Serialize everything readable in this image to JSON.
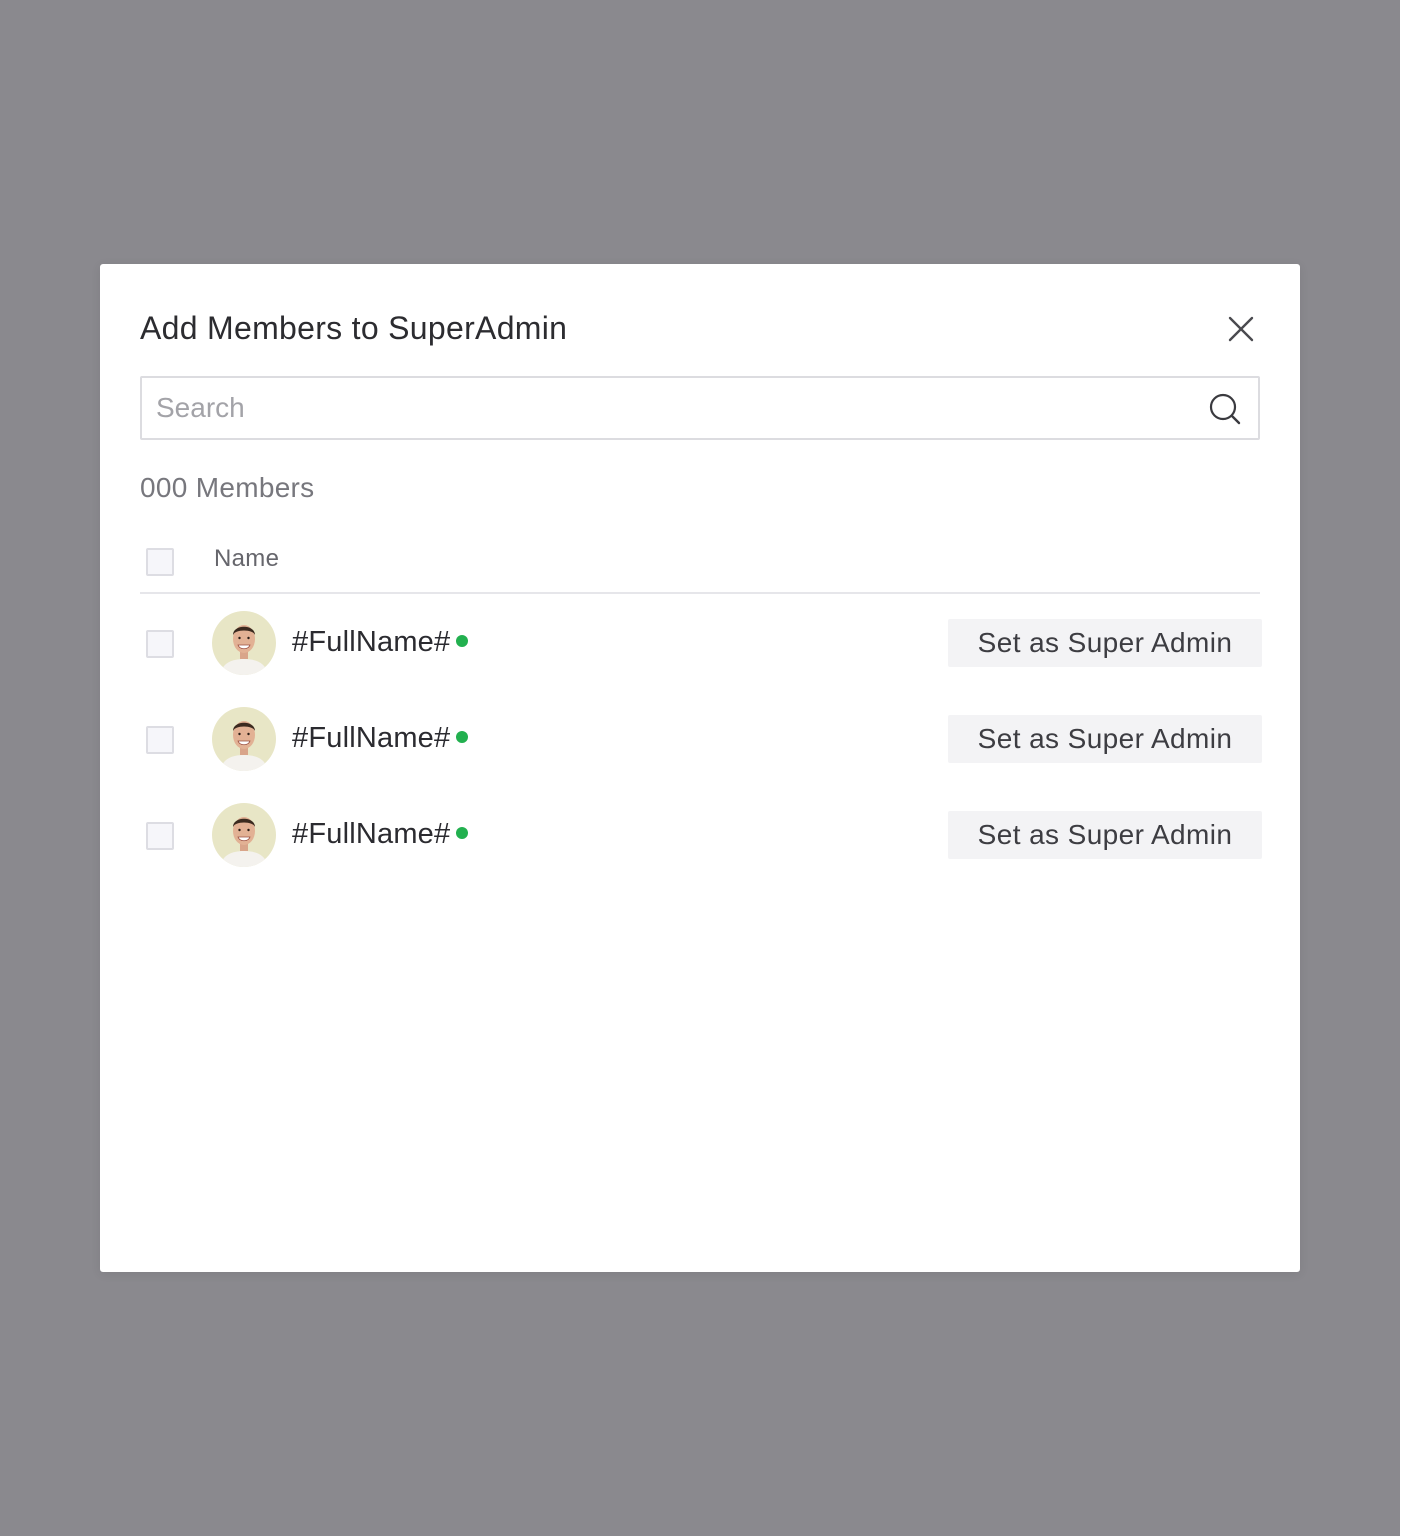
{
  "modal": {
    "title": "Add Members to SuperAdmin",
    "close_icon": "close-icon"
  },
  "search": {
    "placeholder": "Search",
    "value": "",
    "icon": "search-icon"
  },
  "members_summary": {
    "count_label": "000 Members"
  },
  "table": {
    "columns": [
      "Name"
    ],
    "header_checkbox_checked": false,
    "rows": [
      {
        "name": "#FullName#",
        "online": true,
        "checked": false,
        "action_label": "Set as Super Admin",
        "avatar_icon": "avatar"
      },
      {
        "name": "#FullName#",
        "online": true,
        "checked": false,
        "action_label": "Set as Super Admin",
        "avatar_icon": "avatar"
      },
      {
        "name": "#FullName#",
        "online": true,
        "checked": false,
        "action_label": "Set as Super Admin",
        "avatar_icon": "avatar"
      }
    ]
  },
  "colors": {
    "overlay": "#8a898e",
    "modal_background": "#ffffff",
    "online_status": "#22b04f",
    "button_background": "#f3f3f5"
  }
}
